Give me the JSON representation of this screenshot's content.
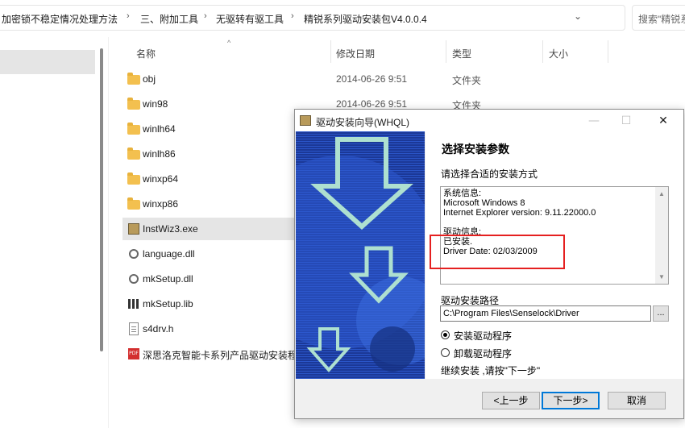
{
  "address": {
    "crumbs": [
      "加密锁不稳定情况处理方法",
      "三、附加工具",
      "无驱转有驱工具",
      "精锐系列驱动安装包V4.0.0.4"
    ],
    "search_placeholder": "搜索\"精锐系"
  },
  "columns": {
    "name": "名称",
    "date": "修改日期",
    "type": "类型",
    "size": "大小"
  },
  "files": [
    {
      "name": "obj",
      "date": "2014-06-26 9:51",
      "type": "文件夹",
      "icon": "folder-icon"
    },
    {
      "name": "win98",
      "date": "2014-06-26 9:51",
      "type": "文件夹",
      "icon": "folder-icon"
    },
    {
      "name": "winlh64",
      "date": "",
      "type": "",
      "icon": "folder-icon"
    },
    {
      "name": "winlh86",
      "date": "",
      "type": "",
      "icon": "folder-icon"
    },
    {
      "name": "winxp64",
      "date": "",
      "type": "",
      "icon": "folder-icon"
    },
    {
      "name": "winxp86",
      "date": "",
      "type": "",
      "icon": "folder-icon"
    },
    {
      "name": "InstWiz3.exe",
      "date": "",
      "type": "",
      "icon": "exe-icon",
      "selected": true
    },
    {
      "name": "language.dll",
      "date": "",
      "type": "",
      "icon": "dll-icon"
    },
    {
      "name": "mkSetup.dll",
      "date": "",
      "type": "",
      "icon": "dll-icon"
    },
    {
      "name": "mkSetup.lib",
      "date": "",
      "type": "",
      "icon": "lib-icon"
    },
    {
      "name": "s4drv.h",
      "date": "",
      "type": "",
      "icon": "header-file-icon"
    },
    {
      "name": "深思洛克智能卡系列产品驱动安装程",
      "date": "",
      "type": "",
      "icon": "pdf-icon"
    }
  ],
  "dialog": {
    "title": "驱动安装向导(WHQL)",
    "heading": "选择安装参数",
    "subheading": "请选择合适的安装方式",
    "info_lines": [
      "系统信息:",
      "Microsoft Windows 8",
      "Internet Explorer version: 9.11.22000.0",
      "",
      "驱动信息:",
      "已安装.",
      "Driver Date: 02/03/2009"
    ],
    "path_label": "驱动安装路径",
    "path_value": "C:\\Program Files\\Senselock\\Driver",
    "browse_label": "...",
    "radio_install": "安装驱动程序",
    "radio_uninstall": "卸载驱动程序",
    "hint": "继续安装 ,请按\"下一步\"",
    "btn_back": "<上一步",
    "btn_next": "下一步>",
    "btn_cancel": "取消",
    "install_selected": true
  },
  "colors": {
    "banner_blue": "#1f3d9e",
    "highlight_red": "#e52020",
    "folder_yellow": "#f3c04f"
  }
}
